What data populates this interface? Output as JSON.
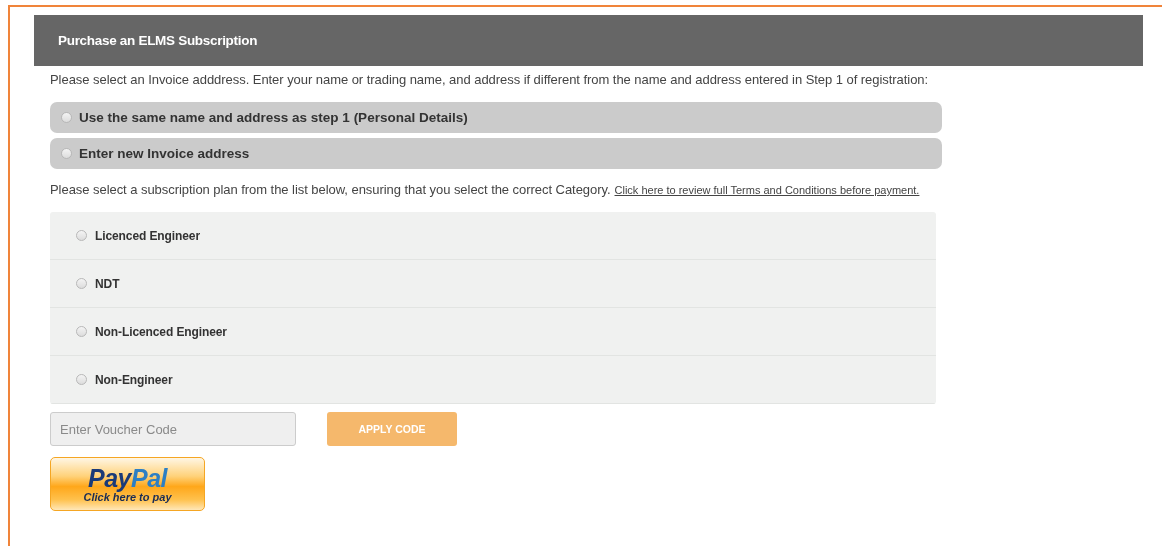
{
  "panel": {
    "title": "Purchase an ELMS Subscription"
  },
  "invoice_intro": "Please select an Invoice adddress. Enter your name or trading name, and address if different from the name and address entered in Step 1 of registration:",
  "invoice_options": [
    {
      "label": "Use the same name and address as step 1 (Personal Details)",
      "selected": false
    },
    {
      "label": "Enter new Invoice address",
      "selected": false
    }
  ],
  "plan_intro": "Please select a subscription plan from the list below, ensuring that you select the correct Category.",
  "terms_link": "Click here to review full Terms and Conditions before payment.",
  "plans": [
    {
      "label": "Licenced Engineer",
      "selected": false
    },
    {
      "label": "NDT",
      "selected": false
    },
    {
      "label": "Non-Licenced Engineer",
      "selected": false
    },
    {
      "label": "Non-Engineer",
      "selected": false
    }
  ],
  "voucher": {
    "placeholder": "Enter Voucher Code",
    "button": "APPLY CODE"
  },
  "paypal": {
    "logo_parts": [
      "Pay",
      "Pal"
    ],
    "caption": "Click here to pay"
  }
}
